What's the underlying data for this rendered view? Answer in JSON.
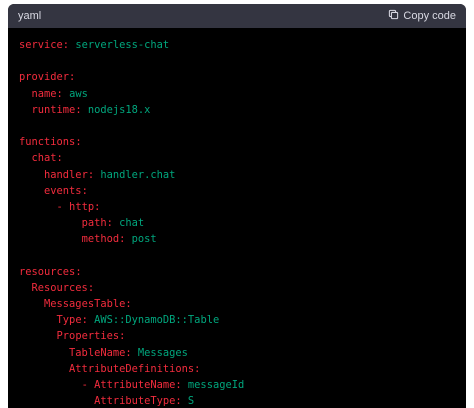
{
  "header": {
    "language": "yaml",
    "copy_label": "Copy code",
    "copy_icon": "clipboard-icon"
  },
  "code": {
    "lines": [
      {
        "indent": "",
        "key": "service",
        "sep": ": ",
        "value": "serverless-chat"
      },
      {
        "indent": "",
        "key": "",
        "sep": "",
        "value": ""
      },
      {
        "indent": "",
        "key": "provider",
        "sep": ":",
        "value": ""
      },
      {
        "indent": "  ",
        "key": "name",
        "sep": ": ",
        "value": "aws"
      },
      {
        "indent": "  ",
        "key": "runtime",
        "sep": ": ",
        "value": "nodejs18.x"
      },
      {
        "indent": "",
        "key": "",
        "sep": "",
        "value": ""
      },
      {
        "indent": "",
        "key": "functions",
        "sep": ":",
        "value": ""
      },
      {
        "indent": "  ",
        "key": "chat",
        "sep": ":",
        "value": ""
      },
      {
        "indent": "    ",
        "key": "handler",
        "sep": ": ",
        "value": "handler.chat"
      },
      {
        "indent": "    ",
        "key": "events",
        "sep": ":",
        "value": ""
      },
      {
        "indent": "      ",
        "key": "- http",
        "sep": ":",
        "value": ""
      },
      {
        "indent": "          ",
        "key": "path",
        "sep": ": ",
        "value": "chat"
      },
      {
        "indent": "          ",
        "key": "method",
        "sep": ": ",
        "value": "post"
      },
      {
        "indent": "",
        "key": "",
        "sep": "",
        "value": ""
      },
      {
        "indent": "",
        "key": "resources",
        "sep": ":",
        "value": ""
      },
      {
        "indent": "  ",
        "key": "Resources",
        "sep": ":",
        "value": ""
      },
      {
        "indent": "    ",
        "key": "MessagesTable",
        "sep": ":",
        "value": ""
      },
      {
        "indent": "      ",
        "key": "Type",
        "sep": ": ",
        "value": "AWS::DynamoDB::Table"
      },
      {
        "indent": "      ",
        "key": "Properties",
        "sep": ":",
        "value": ""
      },
      {
        "indent": "        ",
        "key": "TableName",
        "sep": ": ",
        "value": "Messages"
      },
      {
        "indent": "        ",
        "key": "AttributeDefinitions",
        "sep": ":",
        "value": ""
      },
      {
        "indent": "          ",
        "key": "- AttributeName",
        "sep": ": ",
        "value": "messageId"
      },
      {
        "indent": "            ",
        "key": "AttributeType",
        "sep": ": ",
        "value": "S"
      }
    ]
  }
}
